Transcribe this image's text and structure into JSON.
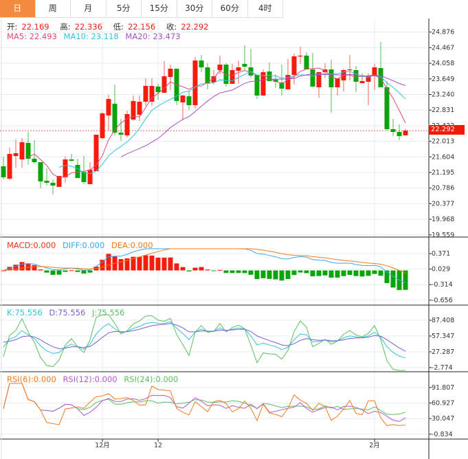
{
  "tabs": [
    {
      "label": "日",
      "active": true
    },
    {
      "label": "周"
    },
    {
      "label": "月"
    },
    {
      "label": "5分"
    },
    {
      "label": "15分"
    },
    {
      "label": "30分"
    },
    {
      "label": "60分"
    },
    {
      "label": "4时"
    }
  ],
  "ohlc": {
    "open_label": "开:",
    "open": "22.169",
    "high_label": "高:",
    "high": "22.336",
    "low_label": "低:",
    "low": "22.156",
    "close_label": "收:",
    "close": "22.292"
  },
  "ma": {
    "ma5": "MA5: 22.493",
    "ma10": "MA10: 23.118",
    "ma20": "MA20: 23.473"
  },
  "macd_legend": {
    "macd": "MACD:0.000",
    "diff": "DIFF:0.000",
    "dea": "DEA:0.000"
  },
  "kdj_legend": {
    "k": "K:75.556",
    "d": "D:75.556",
    "j": "J:75.556"
  },
  "rsi_legend": {
    "rsi6": "RSI(6):0.000",
    "rsi12": "RSI(12):0.000",
    "rsi24": "RSI(24):0.000"
  },
  "last_price": "22.292",
  "colors": {
    "up": "#f41c0c",
    "down": "#0aa30a",
    "ma5": "#e8457a",
    "ma10": "#33c3dc",
    "ma20": "#a94fc8",
    "active_tab": "#f48a3e",
    "diff": "#3ba6f0",
    "dea": "#f57a1c",
    "k": "#33c3dc",
    "d": "#7a5fd0",
    "j": "#5cbf5c",
    "rsi6": "#f57a1c",
    "rsi12": "#b05ad0",
    "rsi24": "#5cbf5c"
  },
  "axes": {
    "price_ticks": [
      "24.876",
      "24.467",
      "24.058",
      "23.649",
      "23.240",
      "22.831",
      "22.422",
      "22.013",
      "21.604",
      "21.195",
      "20.786",
      "20.377",
      "19.968",
      "19.559"
    ],
    "macd_ticks": [
      "0.371",
      "0.029",
      "-0.314",
      "-0.656"
    ],
    "kdj_ticks": [
      "87.408",
      "57.347",
      "27.287",
      "-2.774"
    ],
    "rsi_ticks": [
      "91.807",
      "60.927",
      "30.047",
      "-0.834"
    ],
    "date_labels": [
      {
        "label": "12月",
        "index": 16
      },
      {
        "label": "12",
        "index": 25
      },
      {
        "label": "2月",
        "index": 60
      }
    ]
  },
  "chart_data": {
    "type": "candlestick",
    "ylim": [
      19.559,
      24.876
    ],
    "candles": [
      [
        21.357,
        21.609,
        21.014,
        21.068
      ],
      [
        21.032,
        21.843,
        20.996,
        21.681
      ],
      [
        21.627,
        22.059,
        21.32,
        21.699
      ],
      [
        21.537,
        22.095,
        21.32,
        21.987
      ],
      [
        21.969,
        22.258,
        21.393,
        21.555
      ],
      [
        21.555,
        22.041,
        21.429,
        21.465
      ],
      [
        21.465,
        21.465,
        20.78,
        20.96
      ],
      [
        20.978,
        21.302,
        20.852,
        20.924
      ],
      [
        20.924,
        21.014,
        20.618,
        20.852
      ],
      [
        20.816,
        21.104,
        20.816,
        21.104
      ],
      [
        21.068,
        21.609,
        20.924,
        21.537
      ],
      [
        21.537,
        21.681,
        21.483,
        21.501
      ],
      [
        21.393,
        21.555,
        21.05,
        21.05
      ],
      [
        21.212,
        21.627,
        20.888,
        20.942
      ],
      [
        20.888,
        21.465,
        20.888,
        21.266
      ],
      [
        21.23,
        22.185,
        21.23,
        22.185
      ],
      [
        22.095,
        22.78,
        22.059,
        22.744
      ],
      [
        22.69,
        23.23,
        22.294,
        23.122
      ],
      [
        22.996,
        23.5,
        22.167,
        22.24
      ],
      [
        22.24,
        22.6,
        22.023,
        22.185
      ],
      [
        22.167,
        22.816,
        22.113,
        22.726
      ],
      [
        22.582,
        23.212,
        22.546,
        23.068
      ],
      [
        22.708,
        23.212,
        22.546,
        23.05
      ],
      [
        23.05,
        23.663,
        22.942,
        23.465
      ],
      [
        23.05,
        23.663,
        22.942,
        23.465
      ],
      [
        23.447,
        23.519,
        23.104,
        23.303
      ],
      [
        23.285,
        24.113,
        23.285,
        23.717
      ],
      [
        23.699,
        24.023,
        23.357,
        23.915
      ],
      [
        23.915,
        23.915,
        22.96,
        23.068
      ],
      [
        23.032,
        23.23,
        22.564,
        23.212
      ],
      [
        23.194,
        23.339,
        22.834,
        22.96
      ],
      [
        22.96,
        24.221,
        22.87,
        24.131
      ],
      [
        24.131,
        24.276,
        23.825,
        23.951
      ],
      [
        23.951,
        24.059,
        23.375,
        23.537
      ],
      [
        23.555,
        23.879,
        23.501,
        23.717
      ],
      [
        23.879,
        24.258,
        23.771,
        24.023
      ],
      [
        24.023,
        24.059,
        23.447,
        23.519
      ],
      [
        23.519,
        24.041,
        23.519,
        23.879
      ],
      [
        23.861,
        24.131,
        23.519,
        23.951
      ],
      [
        24.041,
        24.528,
        23.861,
        23.969
      ],
      [
        23.951,
        24.438,
        23.681,
        23.735
      ],
      [
        23.753,
        23.753,
        23.122,
        23.212
      ],
      [
        23.212,
        23.897,
        23.212,
        23.825
      ],
      [
        23.843,
        24.077,
        23.591,
        23.591
      ],
      [
        23.627,
        23.771,
        23.411,
        23.573
      ],
      [
        23.555,
        24.023,
        23.212,
        23.393
      ],
      [
        23.375,
        24.167,
        23.375,
        23.753
      ],
      [
        23.753,
        24.312,
        23.501,
        24.24
      ],
      [
        24.24,
        24.492,
        24.041,
        24.258
      ],
      [
        24.258,
        24.348,
        23.897,
        23.897
      ],
      [
        23.897,
        24.33,
        23.447,
        23.447
      ],
      [
        23.429,
        23.825,
        23.158,
        23.825
      ],
      [
        23.825,
        24.059,
        23.681,
        23.897
      ],
      [
        23.897,
        24.149,
        22.762,
        23.429
      ],
      [
        23.429,
        23.663,
        23.212,
        23.663
      ],
      [
        23.609,
        23.915,
        23.321,
        23.879
      ],
      [
        23.879,
        24.276,
        23.609,
        23.897
      ],
      [
        23.879,
        23.987,
        23.303,
        23.573
      ],
      [
        23.537,
        23.789,
        23.537,
        23.591
      ],
      [
        23.573,
        23.789,
        22.96,
        23.717
      ],
      [
        23.717,
        24.041,
        23.357,
        23.951
      ],
      [
        23.933,
        24.618,
        23.429,
        23.429
      ],
      [
        23.429,
        23.591,
        22.294,
        22.33
      ],
      [
        22.33,
        22.6,
        22.149,
        22.258
      ],
      [
        22.258,
        22.456,
        22.041,
        22.149
      ],
      [
        22.169,
        22.336,
        22.156,
        22.292
      ]
    ],
    "candle_fields": [
      "open",
      "high",
      "low",
      "close"
    ],
    "moving_averages": [
      5,
      10,
      20
    ]
  }
}
